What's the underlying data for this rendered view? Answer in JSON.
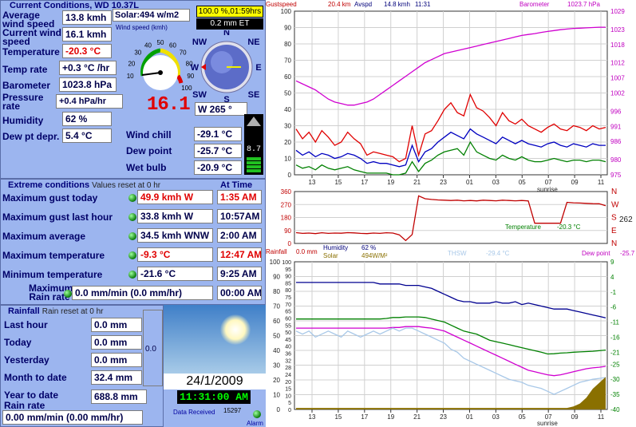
{
  "current": {
    "title": "Current Conditions, WD 10.37L",
    "solar": "Solar:494 w/m2",
    "percent_time": "100.0 %,01:59hrs",
    "et": "0.2 mm ET",
    "gauge_label": "Wind speed (kmh)",
    "gauge_ticks": [
      "10",
      "20",
      "30",
      "40",
      "50",
      "60",
      "70",
      "80",
      "90",
      "100"
    ],
    "compass": [
      "N",
      "NE",
      "E",
      "SE",
      "S",
      "SW",
      "W",
      "NW"
    ],
    "wind_dir": "W  265 °",
    "digital_speed": "16.1",
    "digital_meter": "8.7",
    "rows": [
      {
        "label": "Average wind speed",
        "value": "13.8 kmh"
      },
      {
        "label": "Current wind speed",
        "value": "16.1 kmh"
      },
      {
        "label": "Temperature",
        "value": "-20.3 °C"
      },
      {
        "label": "Temp rate",
        "value": "+0.3 °C /hr"
      },
      {
        "label": "Barometer",
        "value": "1023.8 hPa"
      },
      {
        "label": "Pressure rate",
        "value": "+0.4 hPa/hr"
      },
      {
        "label": "Humidity",
        "value": "62 %"
      },
      {
        "label": "Dew pt depr.",
        "value": "5.4 °C"
      }
    ],
    "right_rows": [
      {
        "label": "Wind chill",
        "value": "-29.1 °C"
      },
      {
        "label": "Dew point",
        "value": "-25.7 °C"
      },
      {
        "label": "Wet bulb",
        "value": "-20.9 °C"
      }
    ]
  },
  "extreme": {
    "title": "Extreme conditions",
    "subtitle": "Values reset at 0 hr",
    "at_time": "At Time",
    "rows": [
      {
        "label": "Maximum gust today",
        "value": "49.9 kmh   W",
        "time": "1:35 AM"
      },
      {
        "label": "Maximum gust last hour",
        "value": "33.8 kmh  W",
        "time": "10:57AM"
      },
      {
        "label": "Maximum average",
        "value": "34.5 kmh WNW",
        "time": "2:00 AM"
      },
      {
        "label": "Maximum temperature",
        "value": "-9.3 °C",
        "time": "12:47 AM"
      },
      {
        "label": "Minimum temperature",
        "value": "-21.6 °C",
        "time": "9:25 AM"
      },
      {
        "label": "Maximum Rain rate",
        "value": "0.0 mm/min (0.0 mm/hr)",
        "time": "00:00 AM"
      }
    ]
  },
  "rainfall": {
    "title": "Rainfall",
    "subtitle": "Rain reset at 0 hr",
    "rows": [
      {
        "label": "Last hour",
        "value": "0.0 mm"
      },
      {
        "label": "Today",
        "value": "0.0 mm"
      },
      {
        "label": "Yesterday",
        "value": "0.0 mm"
      },
      {
        "label": "Month to date",
        "value": "32.4 mm"
      },
      {
        "label": "Year to date",
        "value": "688.8 mm"
      }
    ],
    "gauge_value": "0.0",
    "rate_label": "Rain rate",
    "rate_value": "0.00 mm/min (0.00 mm/hr)"
  },
  "weather": {
    "date": "24/1/2009",
    "time": "11:31:00 AM",
    "data_received_label": "Data Received",
    "data_received_count": "15297",
    "alarm": "Alarm"
  },
  "colors": {
    "panel": "#9cb5ef",
    "gust": "#e00000",
    "avspd": "#0000c0",
    "wind_green": "#008000",
    "barometer": "#d000d0",
    "direction": "#c00000",
    "humidity": "#000090",
    "temperature": "#008000",
    "dewpoint": "#d000d0",
    "thsw": "#a8c8e8",
    "solar": "#8a7000"
  },
  "chart_data": [
    {
      "type": "line",
      "legend": {
        "gust": "Gustspeed",
        "gust_value": "20.4 km",
        "avspd": "Avspd",
        "avspd_value": "14.8 kmh",
        "time": "11:31",
        "baro": "Barometer",
        "baro_value": "1023.7 hPa"
      },
      "x_ticks": [
        "13",
        "15",
        "17",
        "19",
        "21",
        "23",
        "01",
        "03",
        "05",
        "07",
        "09",
        "11"
      ],
      "sunrise_label": "sunrise",
      "y_left": [
        0,
        10,
        20,
        30,
        40,
        50,
        60,
        70,
        80,
        90,
        100
      ],
      "y_right": [
        975,
        980,
        986,
        991,
        996,
        1002,
        1007,
        1012,
        1018,
        1023,
        1029
      ],
      "ylim_left": [
        0,
        100
      ],
      "ylim_right": [
        975,
        1029
      ],
      "series": [
        {
          "name": "Gustspeed",
          "color": "#e00000",
          "values": [
            28,
            22,
            26,
            20,
            27,
            23,
            18,
            20,
            26,
            22,
            19,
            12,
            14,
            13,
            12,
            11,
            8,
            10,
            30,
            12,
            25,
            27,
            33,
            40,
            44,
            38,
            36,
            49,
            41,
            39,
            35,
            30,
            38,
            33,
            31,
            34,
            30,
            28,
            26,
            29,
            31,
            28,
            27,
            30,
            29,
            27,
            30,
            28,
            29
          ]
        },
        {
          "name": "Avspd",
          "color": "#0000c0",
          "values": [
            15,
            12,
            14,
            11,
            13,
            12,
            10,
            11,
            13,
            12,
            10,
            7,
            8,
            7,
            7,
            6,
            5,
            6,
            18,
            8,
            14,
            16,
            20,
            23,
            26,
            24,
            22,
            28,
            25,
            23,
            21,
            19,
            23,
            21,
            19,
            21,
            19,
            18,
            17,
            19,
            20,
            18,
            17,
            19,
            18,
            17,
            19,
            18,
            18
          ]
        },
        {
          "name": "Wind",
          "color": "#008000",
          "values": [
            6,
            4,
            5,
            3,
            6,
            4,
            3,
            4,
            5,
            3,
            2,
            1,
            1,
            1,
            1,
            0,
            0,
            1,
            8,
            2,
            7,
            9,
            12,
            14,
            15,
            16,
            12,
            20,
            14,
            12,
            10,
            9,
            12,
            10,
            9,
            11,
            9,
            8,
            8,
            9,
            10,
            9,
            8,
            9,
            9,
            8,
            9,
            9,
            8
          ]
        },
        {
          "name": "Barometer",
          "color": "#d000d0",
          "axis": "right",
          "values": [
            1006,
            1005,
            1004,
            1003,
            1001.5,
            1000,
            999,
            998.5,
            998,
            998,
            998.5,
            999,
            1000,
            1001.5,
            1003,
            1004.5,
            1006,
            1007.5,
            1009,
            1010.5,
            1012,
            1013,
            1014,
            1015,
            1015.5,
            1016,
            1016.5,
            1017,
            1017.5,
            1018,
            1018.5,
            1019,
            1019.5,
            1020,
            1020.5,
            1021,
            1021.3,
            1021.6,
            1022,
            1022.3,
            1022.6,
            1022.9,
            1023.1,
            1023.3,
            1023.4,
            1023.5,
            1023.6,
            1023.7,
            1023.7
          ]
        }
      ]
    },
    {
      "type": "line",
      "y_ticks": [
        0,
        90,
        180,
        270,
        360
      ],
      "ylim": [
        0,
        360
      ],
      "right_labels": [
        "N",
        "W",
        "S",
        "E",
        "N"
      ],
      "current_value": "262",
      "series": [
        {
          "name": "Wind direction",
          "color": "#c00000",
          "values": [
            75,
            70,
            72,
            68,
            74,
            70,
            72,
            71,
            75,
            73,
            70,
            68,
            72,
            70,
            74,
            72,
            60,
            20,
            62,
            330,
            310,
            305,
            302,
            300,
            298,
            300,
            296,
            298,
            295,
            300,
            298,
            296,
            300,
            298,
            296,
            298,
            295,
            140,
            140,
            140,
            140,
            140,
            285,
            282,
            280,
            278,
            276,
            275,
            262
          ]
        }
      ]
    },
    {
      "type": "line",
      "legend": {
        "rainfall": "Rainfall",
        "rain_value": "0.0 mm",
        "humidity": "Humidity",
        "humidity_value": "62 %",
        "solar": "Solar",
        "solar_value": "494W/M²",
        "thsw": "THSW",
        "thsw_value": "-29.4 °C",
        "temperature": "Temperature",
        "temp_value": "-20.3 °C",
        "dewpoint": "Dew point",
        "dewpoint_value": "-25.7"
      },
      "x_ticks": [
        "13",
        "15",
        "17",
        "19",
        "21",
        "23",
        "01",
        "03",
        "05",
        "07",
        "09",
        "11"
      ],
      "sunrise_label": "sunrise",
      "y_left": [
        0,
        10,
        20,
        30,
        40,
        50,
        60,
        70,
        80,
        90,
        100
      ],
      "y_left2": [
        0,
        5,
        10,
        15,
        20,
        24,
        28,
        32,
        36,
        40,
        45,
        50,
        55,
        60,
        65,
        70,
        75,
        80,
        85,
        90,
        95,
        100
      ],
      "y_left_rain": [
        0,
        4,
        8,
        12,
        16,
        20,
        24,
        28
      ],
      "y_right": [
        9,
        4,
        -1,
        -6,
        -11,
        -16,
        -21,
        -25,
        -30,
        -35,
        -40
      ],
      "ylim_left": [
        0,
        100
      ],
      "ylim_right": [
        -40,
        9
      ],
      "series": [
        {
          "name": "Humidity",
          "color": "#000090",
          "axis": "left",
          "values": [
            86,
            86,
            86,
            86,
            86,
            86,
            86,
            86,
            86,
            86,
            86,
            86,
            86,
            85,
            85,
            85,
            85,
            84,
            84,
            84,
            83,
            82,
            80,
            78,
            76,
            74,
            73,
            73,
            72,
            72,
            72,
            73,
            72,
            72,
            73,
            71,
            72,
            71,
            70,
            69,
            68,
            68,
            68,
            67,
            66,
            65,
            64,
            63,
            62
          ]
        },
        {
          "name": "Temperature",
          "color": "#008000",
          "axis": "right",
          "values": [
            -10,
            -10,
            -10,
            -10,
            -10,
            -10,
            -10,
            -10,
            -10,
            -10,
            -10,
            -10,
            -10,
            -10,
            -9.8,
            -9.5,
            -9.5,
            -9.3,
            -9.3,
            -9.3,
            -9.5,
            -10,
            -10.5,
            -11,
            -12,
            -13,
            -14,
            -14.5,
            -15,
            -16,
            -17,
            -17.5,
            -18,
            -18.5,
            -19,
            -19.5,
            -20,
            -20.5,
            -21,
            -21.6,
            -21.5,
            -21.3,
            -21.2,
            -21,
            -20.9,
            -20.8,
            -20.7,
            -20.5,
            -20.3
          ]
        },
        {
          "name": "Dew point",
          "color": "#d000d0",
          "axis": "right",
          "values": [
            -13,
            -13,
            -13,
            -13,
            -13,
            -13,
            -13,
            -13,
            -13,
            -13,
            -13,
            -13,
            -13,
            -13,
            -13,
            -12.8,
            -12.8,
            -12.5,
            -12.5,
            -12.5,
            -12.8,
            -13,
            -13.5,
            -14,
            -15,
            -16,
            -17,
            -18,
            -19,
            -20,
            -21,
            -22,
            -23,
            -24,
            -25,
            -26,
            -27,
            -27.5,
            -28,
            -28.5,
            -28.8,
            -28.5,
            -28,
            -27.5,
            -27,
            -26.5,
            -26.2,
            -26,
            -25.7
          ]
        },
        {
          "name": "THSW",
          "color": "#a8c8e8",
          "axis": "right",
          "values": [
            -14,
            -15,
            -14,
            -16,
            -15,
            -14,
            -15,
            -16,
            -14,
            -15,
            -16,
            -15,
            -14,
            -15,
            -14,
            -13,
            -14,
            -13,
            -13,
            -14,
            -15,
            -16,
            -17,
            -18,
            -20,
            -21,
            -23,
            -24,
            -25,
            -26,
            -27,
            -28,
            -29,
            -30,
            -30.5,
            -31,
            -32,
            -32.5,
            -33,
            -34,
            -35,
            -34,
            -33,
            -32,
            -31,
            -30.5,
            -30,
            -29.7,
            -29.4
          ]
        },
        {
          "name": "Solar",
          "color": "#8a7000",
          "axis": "rain",
          "values": [
            1,
            1,
            1,
            1,
            1,
            1,
            1,
            1,
            1,
            1,
            1,
            1,
            1,
            1,
            1,
            1,
            1,
            1,
            1,
            1,
            1,
            1,
            1,
            1,
            1,
            1,
            1,
            1,
            1,
            1,
            1,
            1,
            1,
            1,
            1,
            1,
            1,
            1,
            1,
            1,
            1,
            1,
            1,
            2,
            4,
            8,
            14,
            18,
            22
          ]
        }
      ]
    }
  ]
}
